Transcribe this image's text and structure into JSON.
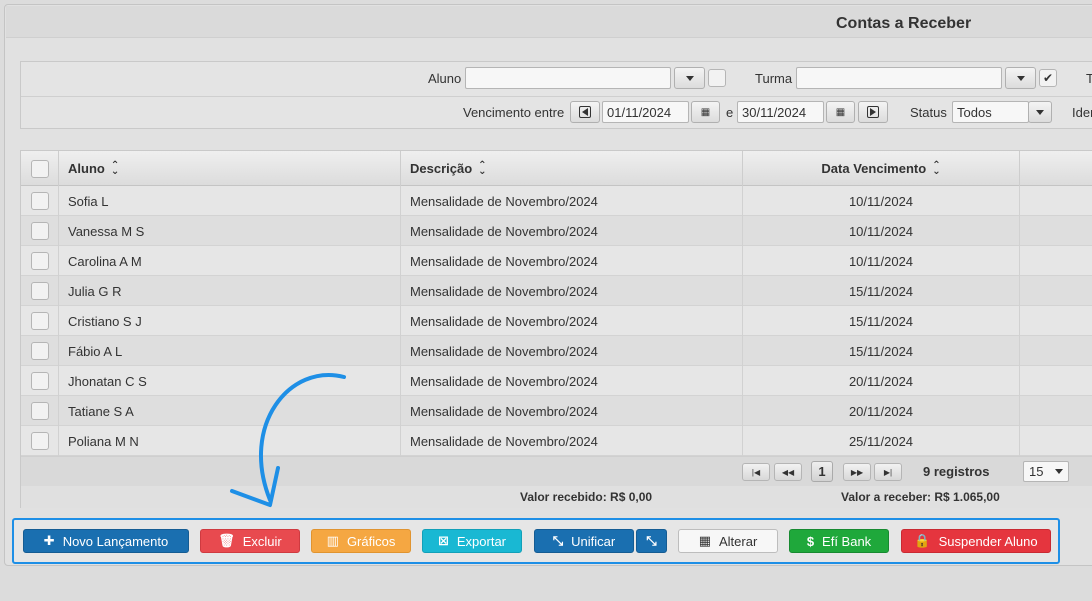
{
  "page": {
    "title": "Contas a Receber"
  },
  "filters": {
    "aluno_label": "Aluno",
    "aluno_value": "",
    "turma_label": "Turma",
    "turma_value": "",
    "t_label_partial": "T",
    "vencimento_label": "Vencimento entre",
    "date_from": "01/11/2024",
    "date_sep": "e",
    "date_to": "30/11/2024",
    "status_label": "Status",
    "status_value": "Todos",
    "ident_label_partial": "Iden"
  },
  "grid": {
    "columns": [
      "Aluno",
      "Descrição",
      "Data Vencimento"
    ],
    "rows": [
      {
        "aluno": "Sofia L",
        "descricao": "Mensalidade de Novembro/2024",
        "vencimento": "10/11/2024"
      },
      {
        "aluno": "Vanessa M S",
        "descricao": "Mensalidade de Novembro/2024",
        "vencimento": "10/11/2024"
      },
      {
        "aluno": "Carolina A M",
        "descricao": "Mensalidade de Novembro/2024",
        "vencimento": "10/11/2024"
      },
      {
        "aluno": "Julia G R",
        "descricao": "Mensalidade de Novembro/2024",
        "vencimento": "15/11/2024"
      },
      {
        "aluno": "Cristiano S J",
        "descricao": "Mensalidade de Novembro/2024",
        "vencimento": "15/11/2024"
      },
      {
        "aluno": "Fábio A L",
        "descricao": "Mensalidade de Novembro/2024",
        "vencimento": "15/11/2024"
      },
      {
        "aluno": "Jhonatan C S",
        "descricao": "Mensalidade de Novembro/2024",
        "vencimento": "20/11/2024"
      },
      {
        "aluno": "Tatiane S A",
        "descricao": "Mensalidade de Novembro/2024",
        "vencimento": "20/11/2024"
      },
      {
        "aluno": "Poliana M N",
        "descricao": "Mensalidade de Novembro/2024",
        "vencimento": "25/11/2024"
      }
    ]
  },
  "pager": {
    "current_page": "1",
    "records": "9 registros",
    "page_size": "15"
  },
  "totals": {
    "recebido": "Valor recebido: R$ 0,00",
    "a_receber": "Valor a receber: R$ 1.065,00"
  },
  "actions": {
    "novo": "Novo Lançamento",
    "excluir": "Excluir",
    "graficos": "Gráficos",
    "exportar": "Exportar",
    "unificar": "Unificar",
    "alterar": "Alterar",
    "efi": "Efí Bank",
    "suspender": "Suspender Aluno"
  },
  "colors": {
    "highlight": "#1e8fe6",
    "primary": "#1a6fb0",
    "danger": "#e84a4f",
    "warning": "#f5a742",
    "info": "#19b8d3",
    "success": "#1fa83b"
  }
}
